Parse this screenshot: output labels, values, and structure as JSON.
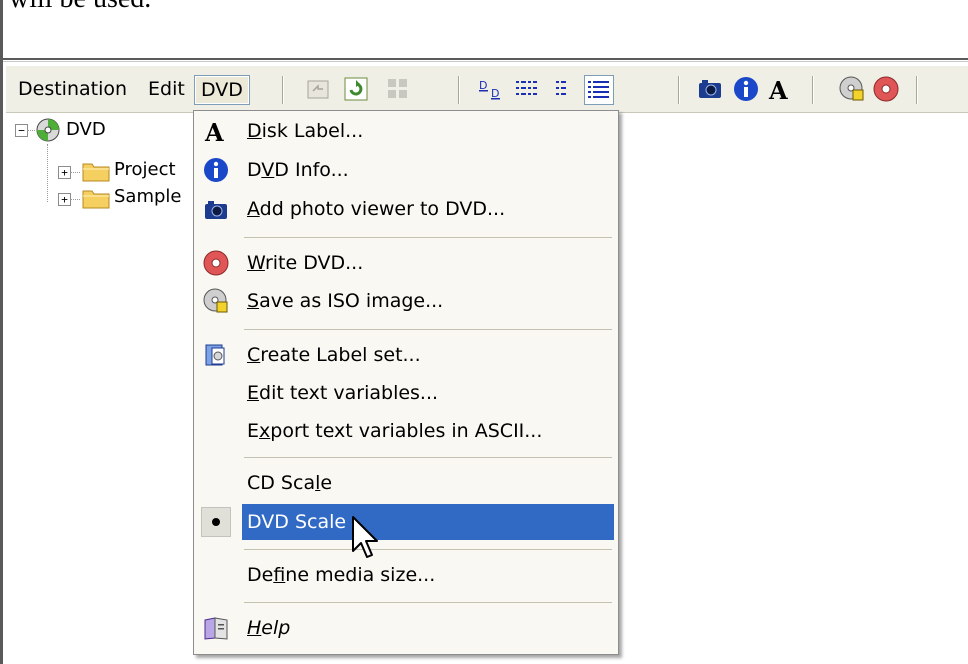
{
  "background_text": "will be used.",
  "toolbar": {
    "menus": [
      {
        "label": "Destination"
      },
      {
        "label": "Edit"
      },
      {
        "label": "DVD"
      }
    ],
    "icons": [
      "up-folder-icon",
      "refresh-icon",
      "thumbnails-icon",
      "large-icons-view-icon",
      "small-icons-view-icon",
      "list-view-icon",
      "details-view-icon",
      "photo-viewer-icon",
      "info-icon",
      "label-font-icon",
      "save-iso-icon",
      "write-disc-icon"
    ]
  },
  "tree": {
    "root": {
      "label": "DVD",
      "expander": "−"
    },
    "children": [
      {
        "label": "Project",
        "expander": "+"
      },
      {
        "label": "Sample",
        "expander": "+"
      }
    ]
  },
  "dvd_menu": {
    "items": [
      {
        "key": "disk_label",
        "pre": "",
        "mn": "D",
        "post": "isk Label...",
        "icon": "font-a-icon"
      },
      {
        "key": "dvd_info",
        "pre": "D",
        "mn": "V",
        "post": "D Info...",
        "icon": "info-icon"
      },
      {
        "key": "add_photo_viewer",
        "pre": "",
        "mn": "A",
        "post": "dd photo viewer to DVD...",
        "icon": "camera-icon"
      },
      {
        "key": "write_dvd",
        "pre": "",
        "mn": "W",
        "post": "rite DVD...",
        "icon": "write-disc-icon"
      },
      {
        "key": "save_iso",
        "pre": "",
        "mn": "S",
        "post": "ave as ISO image...",
        "icon": "iso-disc-icon"
      },
      {
        "key": "create_label_set",
        "pre": "",
        "mn": "C",
        "post": "reate Label set...",
        "icon": "label-set-icon"
      },
      {
        "key": "edit_text_vars",
        "pre": "",
        "mn": "E",
        "post": "dit text variables...",
        "icon": ""
      },
      {
        "key": "export_text_vars",
        "pre": "E",
        "mn": "x",
        "post": "port text variables in ASCII...",
        "icon": ""
      },
      {
        "key": "cd_scale",
        "pre": "CD Sca",
        "mn": "l",
        "post": "e",
        "icon": ""
      },
      {
        "key": "dvd_scale",
        "pre": "DVD Scale",
        "mn": "",
        "post": "",
        "icon": "",
        "checked": true,
        "highlighted": true
      },
      {
        "key": "define_media_size",
        "pre": "De",
        "mn": "f",
        "post": "ine media size...",
        "icon": ""
      },
      {
        "key": "help",
        "pre": "",
        "mn": "H",
        "post": "elp",
        "icon": "help-book-icon",
        "italic": true
      }
    ]
  },
  "colors": {
    "highlight": "#316ac5",
    "menu_bg": "#f9f8f3",
    "toolbar_bg": "#f0efe6"
  }
}
